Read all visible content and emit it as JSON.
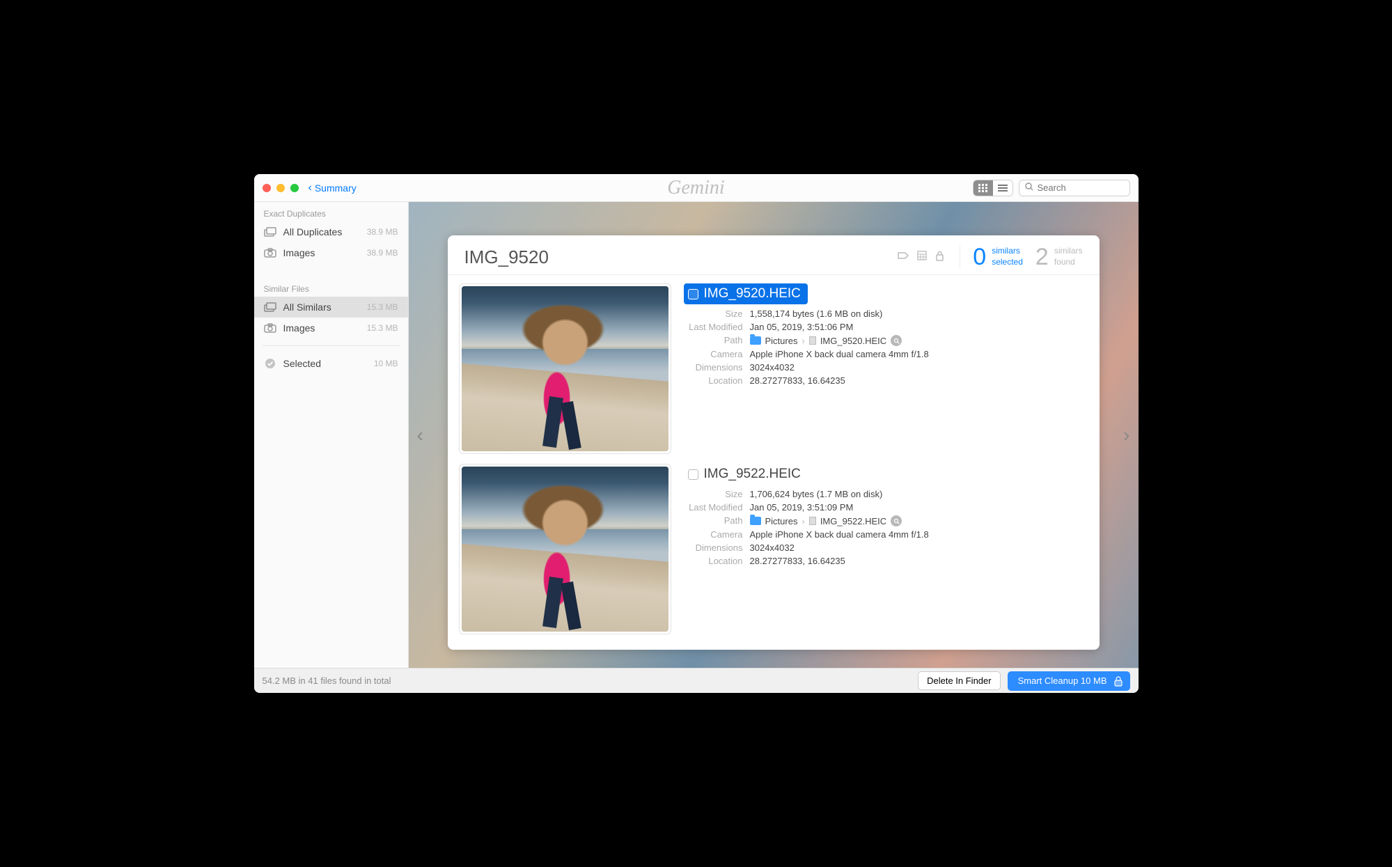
{
  "header": {
    "back_label": "Summary",
    "app_name": "Gemini",
    "search_placeholder": "Search"
  },
  "sidebar": {
    "section_exact": "Exact Duplicates",
    "items_exact": [
      {
        "label": "All Duplicates",
        "size": "38.9 MB"
      },
      {
        "label": "Images",
        "size": "38.9 MB"
      }
    ],
    "section_similar": "Similar Files",
    "items_similar": [
      {
        "label": "All Similars",
        "size": "15.3 MB"
      },
      {
        "label": "Images",
        "size": "15.3 MB"
      }
    ],
    "selected_label": "Selected",
    "selected_size": "10 MB"
  },
  "detail": {
    "title": "IMG_9520",
    "selected_count": "0",
    "selected_l1": "similars",
    "selected_l2": "selected",
    "found_count": "2",
    "found_l1": "similars",
    "found_l2": "found",
    "labels": {
      "size": "Size",
      "modified": "Last Modified",
      "path": "Path",
      "camera": "Camera",
      "dimensions": "Dimensions",
      "location": "Location"
    },
    "path_folder": "Pictures",
    "files": [
      {
        "name": "IMG_9520.HEIC",
        "size": "1,558,174 bytes (1.6 MB on disk)",
        "modified": "Jan 05, 2019, 3:51:06 PM",
        "path_file": "IMG_9520.HEIC",
        "camera": "Apple iPhone X back dual camera 4mm f/1.8",
        "dimensions": "3024x4032",
        "location": "28.27277833, 16.64235"
      },
      {
        "name": "IMG_9522.HEIC",
        "size": "1,706,624 bytes (1.7 MB on disk)",
        "modified": "Jan 05, 2019, 3:51:09 PM",
        "path_file": "IMG_9522.HEIC",
        "camera": "Apple iPhone X back dual camera 4mm f/1.8",
        "dimensions": "3024x4032",
        "location": "28.27277833, 16.64235"
      }
    ]
  },
  "footer": {
    "summary": "54.2 MB in 41 files found in total",
    "delete_label": "Delete In Finder",
    "cleanup_label": "Smart Cleanup 10 MB"
  }
}
